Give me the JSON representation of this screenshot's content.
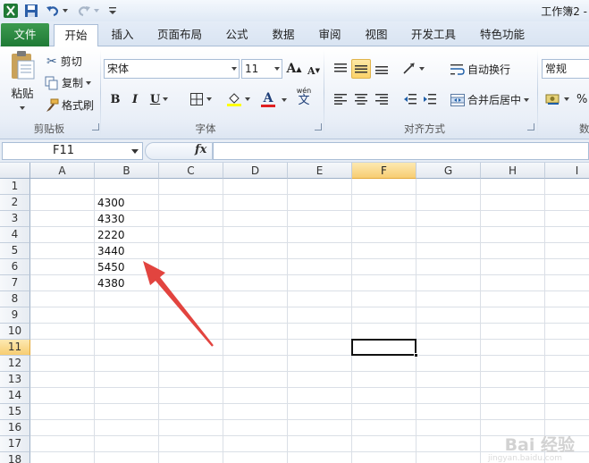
{
  "window": {
    "title": "工作簿2 -"
  },
  "quick_access": {
    "icons": [
      "excel-logo-icon",
      "save-icon",
      "undo-icon",
      "redo-icon",
      "customize-icon"
    ]
  },
  "tabs": [
    {
      "label": "文件"
    },
    {
      "label": "开始"
    },
    {
      "label": "插入"
    },
    {
      "label": "页面布局"
    },
    {
      "label": "公式"
    },
    {
      "label": "数据"
    },
    {
      "label": "审阅"
    },
    {
      "label": "视图"
    },
    {
      "label": "开发工具"
    },
    {
      "label": "特色功能"
    }
  ],
  "ribbon": {
    "clipboard": {
      "label": "剪贴板",
      "paste": "粘贴",
      "cut": "剪切",
      "copy": "复制",
      "format_painter": "格式刷"
    },
    "font": {
      "label": "字体",
      "font_name": "宋体",
      "font_size": "11",
      "bold": "B",
      "italic": "I",
      "underline": "U",
      "font_color_letter": "A",
      "grow_glyph": "A",
      "shrink_glyph": "A",
      "phonetic_glyph": "wén",
      "phonetic_char": "文",
      "highlight_color": "#ffff00",
      "font_color": "#e02020"
    },
    "alignment": {
      "label": "对齐方式",
      "wrap_text": "自动换行",
      "merge_center": "合并后居中"
    },
    "number": {
      "format": "常规",
      "percent": "%",
      "label": "数"
    }
  },
  "formula_bar": {
    "name_box": "F11",
    "fx": "fx",
    "value": ""
  },
  "sheet": {
    "columns": [
      "A",
      "B",
      "C",
      "D",
      "E",
      "F",
      "G",
      "H",
      "I"
    ],
    "rows": [
      "1",
      "2",
      "3",
      "4",
      "5",
      "6",
      "7",
      "8",
      "9",
      "10",
      "11",
      "12",
      "13",
      "14",
      "15",
      "16",
      "17",
      "18"
    ],
    "selected_column": "F",
    "selected_row": "11",
    "column_b_values": [
      "4300",
      "4330",
      "2220",
      "3440",
      "5450",
      "4380"
    ],
    "annotation_arrow_color": "#e2443f"
  },
  "watermark": {
    "text": "Bai 经验",
    "sub": "jingyan.baidu.com"
  }
}
